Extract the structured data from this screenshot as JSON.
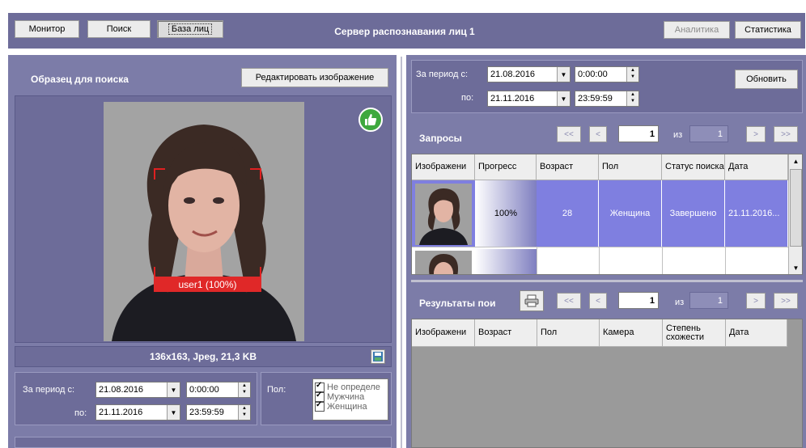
{
  "topbar": {
    "monitor": "Монитор",
    "search": "Поиск",
    "facebase": "База лиц",
    "title": "Сервер распознавания лиц 1",
    "analytics": "Аналитика",
    "statistics": "Статистика"
  },
  "sample": {
    "title": "Образец для поиска",
    "edit_button": "Редактировать изображение",
    "face_label": "user1 (100%)",
    "image_info": "136x163, Jpeg, 21,3 KB"
  },
  "left_filter": {
    "period_from_label": "За период с:",
    "date_from": "21.08.2016",
    "time_from": "0:00:00",
    "to_label": "по:",
    "date_to": "21.11.2016",
    "time_to": "23:59:59",
    "gender_label": "Пол:",
    "gender_options": [
      "Не определе",
      "Мужчина",
      "Женщина"
    ]
  },
  "right_filter": {
    "period_from_label": "За период с:",
    "date_from": "21.08.2016",
    "time_from": "0:00:00",
    "to_label": "по:",
    "date_to": "21.11.2016",
    "time_to": "23:59:59",
    "refresh": "Обновить"
  },
  "requests": {
    "title": "Запросы",
    "first": "<<",
    "prev": "<",
    "page": "1",
    "of_label": "из",
    "total": "1",
    "next": ">",
    "last": ">>",
    "columns": [
      "Изображени",
      "Прогресс",
      "Возраст",
      "Пол",
      "Статус поиска",
      "Дата"
    ],
    "row": {
      "progress": "100%",
      "age": "28",
      "gender": "Женщина",
      "status": "Завершено",
      "date": "21.11.2016..."
    }
  },
  "results": {
    "title": "Результаты пои",
    "first": "<<",
    "prev": "<",
    "page": "1",
    "of_label": "из",
    "total": "1",
    "next": ">",
    "last": ">>",
    "columns": [
      "Изображени",
      "Возраст",
      "Пол",
      "Камера",
      "Степень схожести",
      "Дата"
    ]
  },
  "colors": {
    "panel": "#7c7ca8",
    "selected_row": "#7f7fe0",
    "face_frame": "#e02020"
  }
}
